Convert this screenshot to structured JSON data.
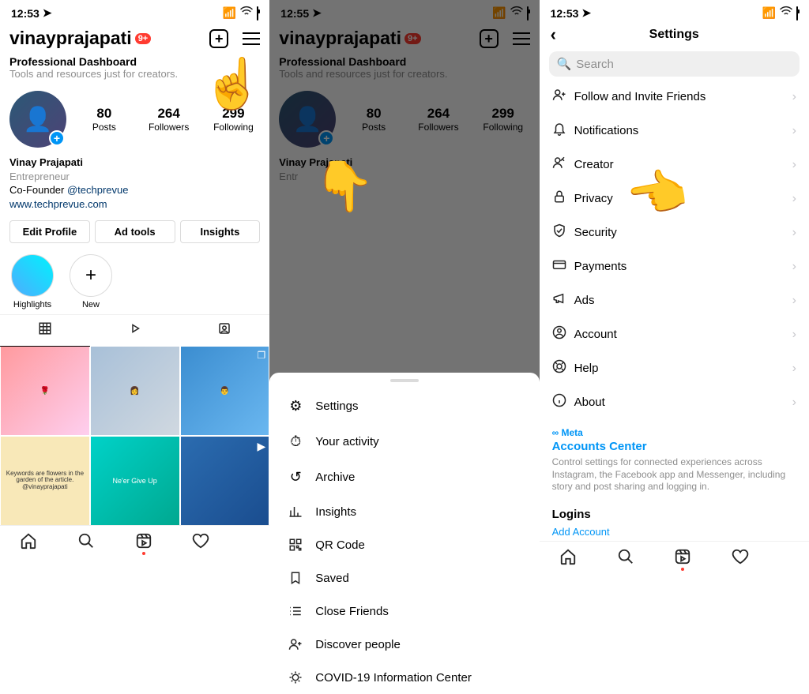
{
  "status": {
    "time1": "12:53",
    "time2": "12:55",
    "time3": "12:53"
  },
  "profile": {
    "username": "vinayprajapati",
    "badge": "9+",
    "dashboard_title": "Professional Dashboard",
    "dashboard_sub": "Tools and resources just for creators.",
    "stats": {
      "posts_n": "80",
      "posts_l": "Posts",
      "followers_n": "264",
      "followers_l": "Followers",
      "following_n": "299",
      "following_l": "Following"
    },
    "name": "Vinay Prajapati",
    "category": "Entrepreneur",
    "cofounder": "Co-Founder ",
    "handle": "@techprevue",
    "site": "www.techprevue.com",
    "btn_edit": "Edit Profile",
    "btn_ads": "Ad tools",
    "btn_insights": "Insights",
    "hl1": "Highlights",
    "hl2": "New"
  },
  "menu": {
    "settings": "Settings",
    "activity": "Your activity",
    "archive": "Archive",
    "insights": "Insights",
    "qr": "QR Code",
    "saved": "Saved",
    "close": "Close Friends",
    "discover": "Discover people",
    "covid": "COVID-19 Information Center"
  },
  "settings": {
    "title": "Settings",
    "search": "Search",
    "follow": "Follow and Invite Friends",
    "notifications": "Notifications",
    "creator": "Creator",
    "privacy": "Privacy",
    "security": "Security",
    "payments": "Payments",
    "ads": "Ads",
    "account": "Account",
    "help": "Help",
    "about": "About",
    "meta": "Meta",
    "accounts_center": "Accounts Center",
    "ac_desc": "Control settings for connected experiences across Instagram, the Facebook app and Messenger, including story and post sharing and logging in.",
    "logins": "Logins",
    "add_account": "Add Account"
  },
  "grid_texts": {
    "c4": "Keywords are flowers in the garden of the article.",
    "c4b": "@vinayprajapati",
    "c5": "Ne'er Give Up"
  }
}
